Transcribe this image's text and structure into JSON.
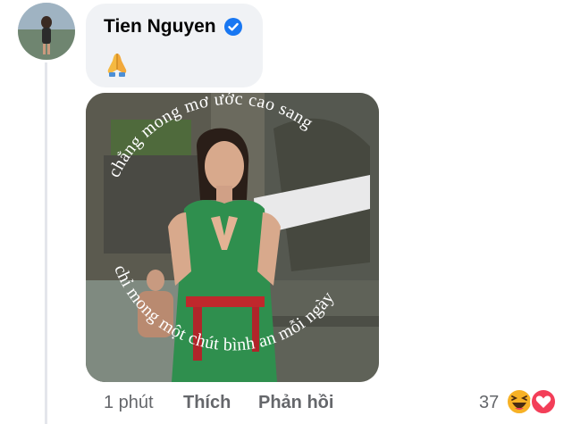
{
  "comment": {
    "author": "Tien Nguyen",
    "verified": true,
    "text_icon": "folded-hands-icon"
  },
  "image": {
    "caption_top": "chẳng mong mơ ước cao sang",
    "caption_bottom": "chỉ mong một chút bình an mỗi ngày"
  },
  "footer": {
    "time": "1 phút",
    "like_label": "Thích",
    "reply_label": "Phản hồi"
  },
  "reactions": {
    "count": "37",
    "icons": [
      "haha-icon",
      "love-icon"
    ]
  },
  "colors": {
    "bubble": "#f0f2f5",
    "verified": "#1877f2",
    "secondary_text": "#65676b",
    "love": "#f33e58",
    "haha": "#f7b125"
  }
}
